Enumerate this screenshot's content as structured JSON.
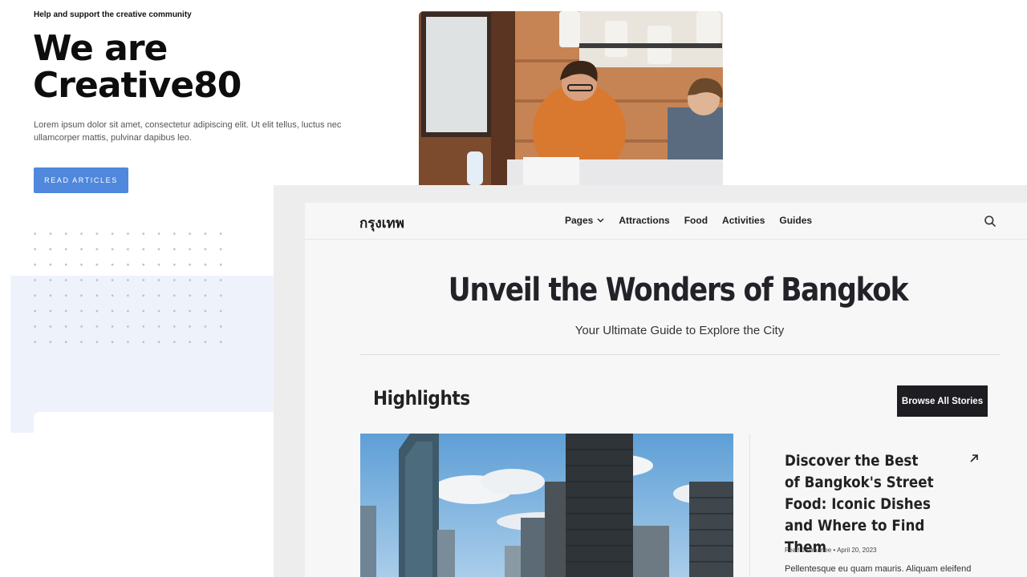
{
  "creative": {
    "eyebrow": "Help and support the creative community",
    "title_line1": "We are",
    "title_line2": "Creative80",
    "description": "Lorem ipsum dolor sit amet, consectetur adipiscing elit. Ut elit tellus, luctus nec ullamcorper mattis, pulvinar dapibus leo.",
    "button_label": "READ ARTICLES",
    "accent_color": "#4f88dc"
  },
  "bangkok": {
    "brand": "กรุงเทพ",
    "nav": {
      "items": [
        "Pages",
        "Attractions",
        "Food",
        "Activities",
        "Guides"
      ]
    },
    "hero_title": "Unveil the Wonders of Bangkok",
    "hero_subtitle": "Your Ultimate Guide to Explore the City",
    "section_title": "Highlights",
    "browse_label": "Browse All Stories",
    "story": {
      "title": "Discover the Best of Bangkok's Street Food: Iconic Dishes and Where to Find Them",
      "author": "Pearl Janmanee",
      "date": "April 20, 2023",
      "excerpt": "Pellentesque eu quam mauris. Aliquam eleifend"
    }
  }
}
